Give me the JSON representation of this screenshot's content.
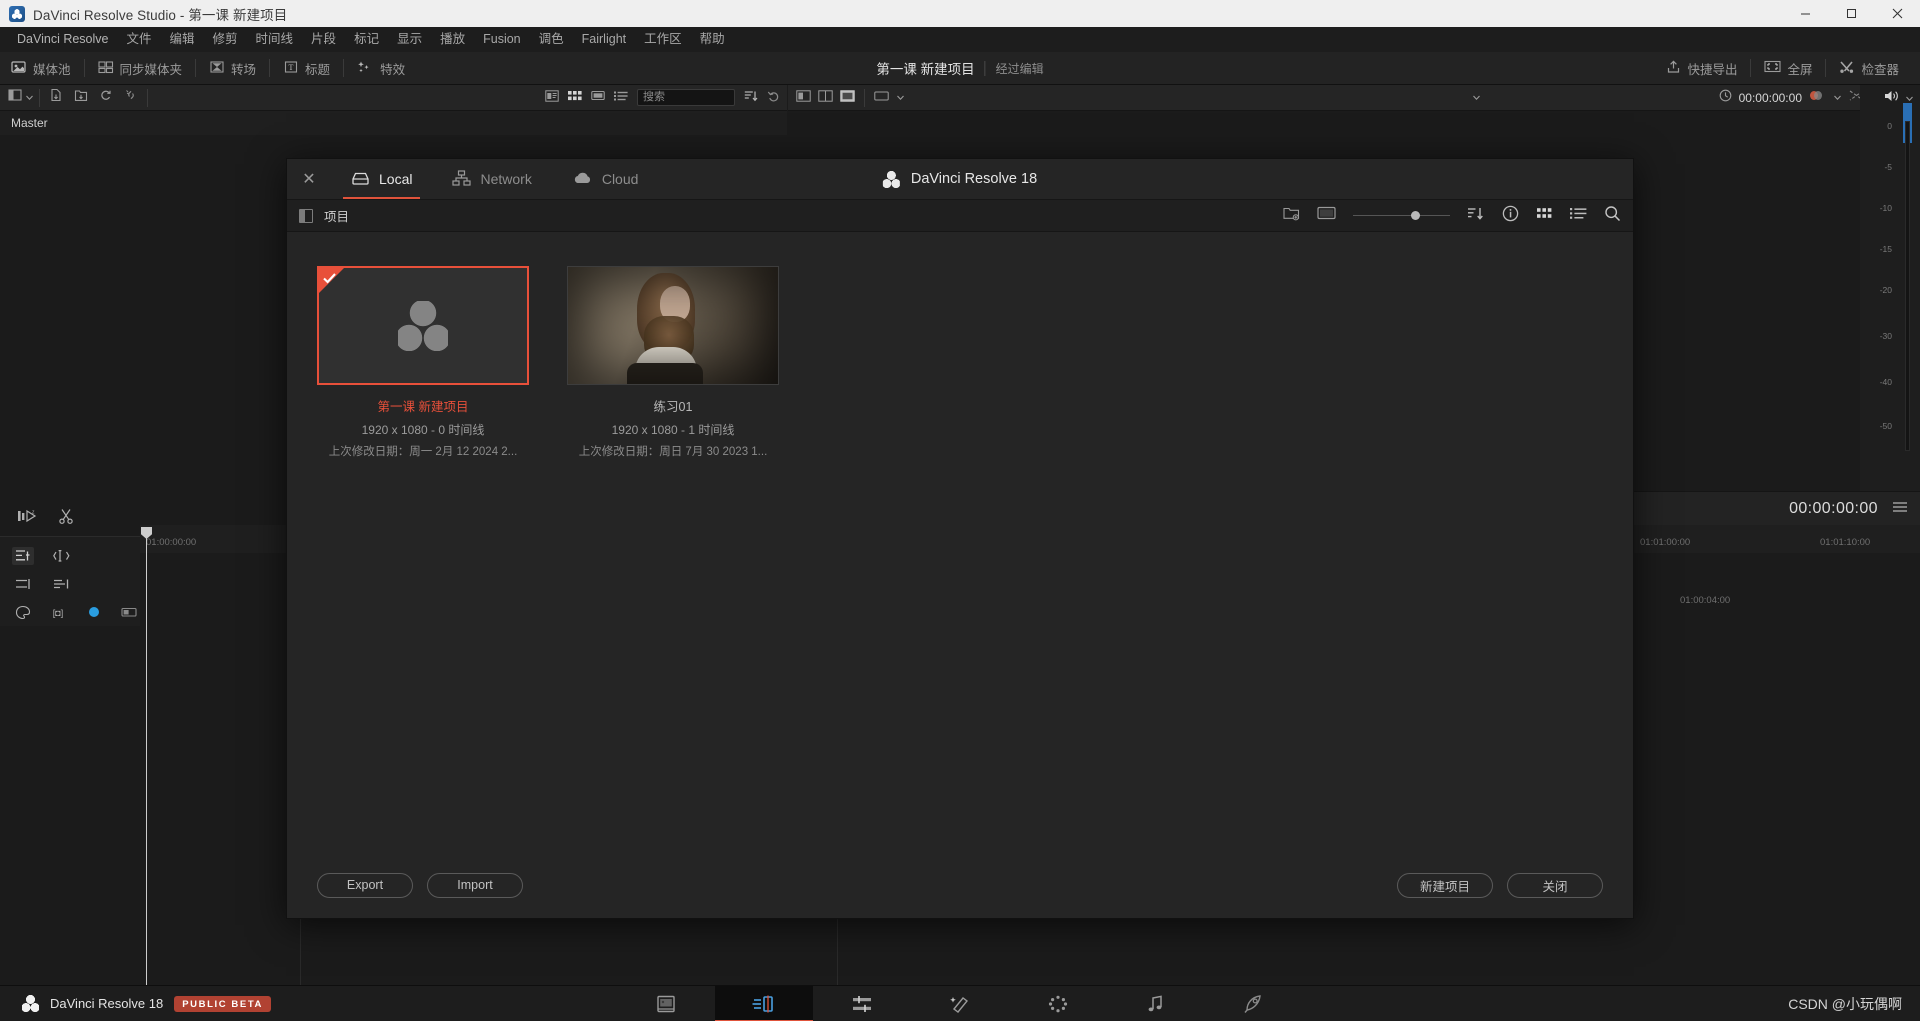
{
  "window": {
    "title": "DaVinci Resolve Studio - 第一课 新建项目",
    "minimize_label": "—",
    "maximize_label": "□",
    "close_label": "✕"
  },
  "menubar": {
    "items": [
      {
        "label": "DaVinci Resolve"
      },
      {
        "label": "文件"
      },
      {
        "label": "编辑"
      },
      {
        "label": "修剪"
      },
      {
        "label": "时间线"
      },
      {
        "label": "片段"
      },
      {
        "label": "标记"
      },
      {
        "label": "显示"
      },
      {
        "label": "播放"
      },
      {
        "label": "Fusion"
      },
      {
        "label": "调色"
      },
      {
        "label": "Fairlight"
      },
      {
        "label": "工作区"
      },
      {
        "label": "帮助"
      }
    ]
  },
  "toolbar": {
    "left_items": [
      {
        "label": "媒体池",
        "icon": "media-pool-icon"
      },
      {
        "label": "同步媒体夹",
        "icon": "sync-bin-icon"
      },
      {
        "label": "转场",
        "icon": "transitions-icon"
      },
      {
        "label": "标题",
        "icon": "titles-icon"
      },
      {
        "label": "特效",
        "icon": "effects-icon"
      }
    ],
    "project_name": "第一课 新建项目",
    "project_status": "经过编辑",
    "right_items": [
      {
        "label": "快捷导出",
        "icon": "quick-export-icon"
      },
      {
        "label": "全屏",
        "icon": "fullscreen-icon"
      },
      {
        "label": "检查器",
        "icon": "inspector-icon"
      }
    ]
  },
  "media_pool": {
    "search_placeholder": "搜索",
    "master_label": "Master",
    "icons": [
      "sidebar-toggle-icon",
      "chevron-down-icon",
      "import-media-icon",
      "import-folder-icon",
      "refresh-icon",
      "unlink-icon",
      "metadata-view-icon",
      "thumbnail-view-icon",
      "filmstrip-view-icon",
      "list-view-icon",
      "sort-icon",
      "undo-icon"
    ]
  },
  "viewer": {
    "timecode": "00:00:00:00",
    "transport_timecode": "00:00:00:00"
  },
  "audio_meter": {
    "ticks": [
      "0",
      "-5",
      "-10",
      "-15",
      "-20",
      "-30",
      "-40",
      "-50"
    ]
  },
  "timeline": {
    "start_timecode": "01:00:00:00",
    "ruler_marks": [
      "01:00:00:00",
      "01:00:04:00",
      "01:01:00:00",
      "01:01:10:00"
    ]
  },
  "modal": {
    "close_icon": "close-icon",
    "tabs": [
      {
        "label": "Local",
        "icon": "drive-icon",
        "active": true
      },
      {
        "label": "Network",
        "icon": "network-icon",
        "active": false
      },
      {
        "label": "Cloud",
        "icon": "cloud-icon",
        "active": false
      }
    ],
    "title": "DaVinci Resolve 18",
    "sub_label": "项目",
    "sub_icons": [
      "new-folder-icon",
      "display-icon",
      "zoom-slider",
      "sort-icon",
      "info-icon",
      "grid-view-icon",
      "list-view-icon",
      "search-icon"
    ],
    "projects": [
      {
        "name": "第一课 新建项目",
        "meta": "1920 x 1080 - 0 时间线",
        "date": "上次修改日期：周一 2月 12 2024 2...",
        "selected": true,
        "thumb": "davinci-logo"
      },
      {
        "name": "练习01",
        "meta": "1920 x 1080 - 1 时间线",
        "date": "上次修改日期：周日 7月 30 2023 1...",
        "selected": false,
        "thumb": "portrait-photo"
      }
    ],
    "buttons": {
      "export": "Export",
      "import": "Import",
      "new_project": "新建项目",
      "close": "关闭"
    }
  },
  "statusbar": {
    "app_name": "DaVinci Resolve 18",
    "badge": "PUBLIC BETA",
    "pages": [
      {
        "name": "media-page",
        "icon": "media-page-icon",
        "active": false
      },
      {
        "name": "cut-page",
        "icon": "cut-page-icon",
        "active": true
      },
      {
        "name": "edit-page",
        "icon": "edit-page-icon",
        "active": false
      },
      {
        "name": "fusion-page",
        "icon": "fusion-page-icon",
        "active": false
      },
      {
        "name": "color-page",
        "icon": "color-page-icon",
        "active": false
      },
      {
        "name": "fairlight-page",
        "icon": "fairlight-page-icon",
        "active": false
      },
      {
        "name": "deliver-page",
        "icon": "deliver-page-icon",
        "active": false
      }
    ],
    "watermark": "CSDN @小玩偶啊"
  },
  "colors": {
    "accent": "#e0533b",
    "selection": "#e8503a",
    "badge": "#b14232"
  }
}
